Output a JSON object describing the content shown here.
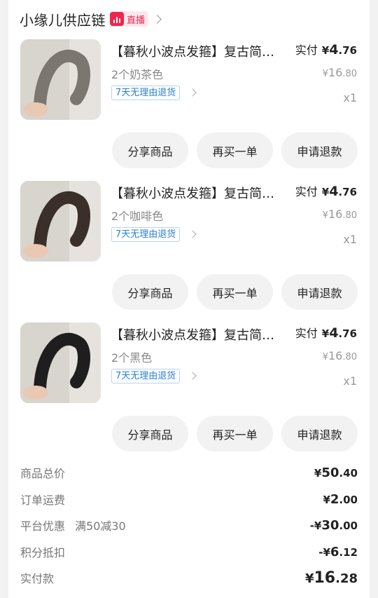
{
  "shop": {
    "name": "小缘儿供应链",
    "live_label": "直播"
  },
  "items": [
    {
      "title": "【暮秋小波点发箍】复古简约波点发箍",
      "variant": "2个奶茶色",
      "return_tag": "7天无理由退货",
      "paid_label": "实付",
      "price": {
        "sym": "¥",
        "int": "4",
        "dec": ".76"
      },
      "original": {
        "sym": "¥",
        "int": "16",
        "dec": ".80"
      },
      "qty": "x1",
      "color": "#7b7670",
      "buttons": {
        "share": "分享商品",
        "rebuy": "再买一单",
        "refund": "申请退款"
      }
    },
    {
      "title": "【暮秋小波点发箍】复古简约波点发箍",
      "variant": "2个咖啡色",
      "return_tag": "7天无理由退货",
      "paid_label": "实付",
      "price": {
        "sym": "¥",
        "int": "4",
        "dec": ".76"
      },
      "original": {
        "sym": "¥",
        "int": "16",
        "dec": ".80"
      },
      "qty": "x1",
      "color": "#3b2f2a",
      "buttons": {
        "share": "分享商品",
        "rebuy": "再买一单",
        "refund": "申请退款"
      }
    },
    {
      "title": "【暮秋小波点发箍】复古简约波点发箍",
      "variant": "2个黑色",
      "return_tag": "7天无理由退货",
      "paid_label": "实付",
      "price": {
        "sym": "¥",
        "int": "4",
        "dec": ".76"
      },
      "original": {
        "sym": "¥",
        "int": "16",
        "dec": ".80"
      },
      "qty": "x1",
      "color": "#1e1e1e",
      "buttons": {
        "share": "分享商品",
        "rebuy": "再买一单",
        "refund": "申请退款"
      }
    }
  ],
  "summary": {
    "total": {
      "label": "商品总价",
      "sym": "¥",
      "int": "50",
      "dec": ".40"
    },
    "shipping": {
      "label": "订单运费",
      "sym": "¥",
      "int": "2",
      "dec": ".00"
    },
    "platform": {
      "label": "平台优惠",
      "note": "满50减30",
      "sym": "-¥",
      "int": "30",
      "dec": ".00"
    },
    "points": {
      "label": "积分抵扣",
      "sym": "-¥",
      "int": "6",
      "dec": ".12"
    },
    "paid": {
      "label": "实付款",
      "sym": "¥",
      "int": "16",
      "dec": ".28"
    }
  },
  "colors": {
    "accent": "#f0254e",
    "link": "#2b7fd4",
    "button_bg": "#f2f2f2"
  }
}
